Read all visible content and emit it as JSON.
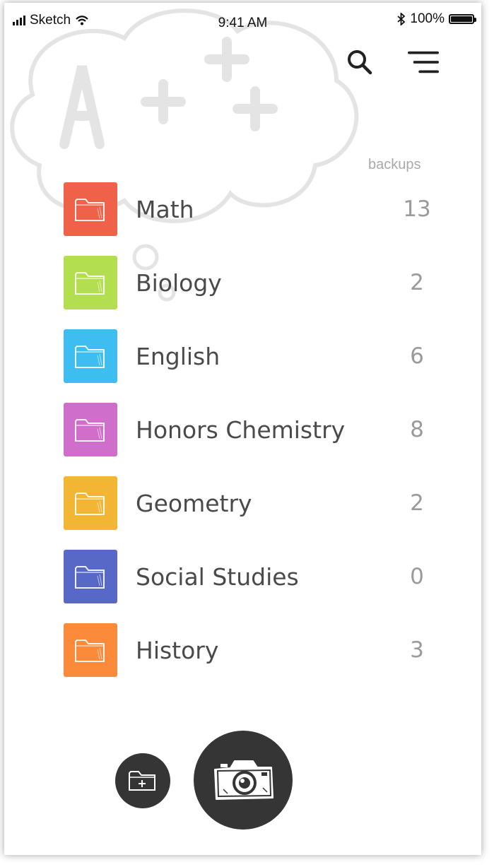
{
  "status_bar": {
    "carrier": "Sketch",
    "time": "9:41 AM",
    "battery": "100%"
  },
  "header": {
    "search_icon": "search-icon",
    "menu_icon": "menu-icon",
    "count_column_label": "backups"
  },
  "folders": [
    {
      "name": "Math",
      "count": "13",
      "color": "#f0614a"
    },
    {
      "name": "Biology",
      "count": "2",
      "color": "#b3de4f"
    },
    {
      "name": "English",
      "count": "6",
      "color": "#3ebdf0"
    },
    {
      "name": "Honors Chemistry",
      "count": "8",
      "color": "#cf6ecb"
    },
    {
      "name": "Geometry",
      "count": "2",
      "color": "#f2b534"
    },
    {
      "name": "Social Studies",
      "count": "0",
      "color": "#5868c6"
    },
    {
      "name": "History",
      "count": "3",
      "color": "#fb8a3a"
    }
  ],
  "actions": {
    "add_folder_icon": "add-folder-icon",
    "camera_icon": "camera-icon"
  }
}
